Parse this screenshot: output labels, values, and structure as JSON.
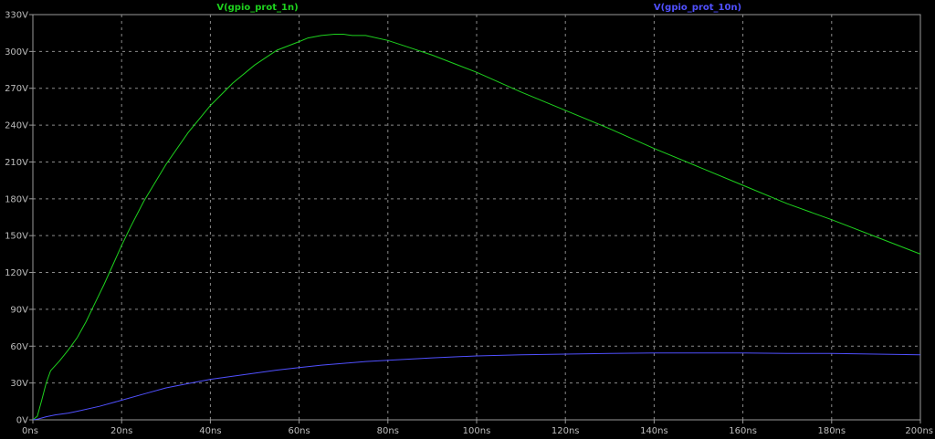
{
  "chart_data": {
    "type": "line",
    "title": "",
    "xlabel": "",
    "ylabel": "",
    "xlim": [
      0,
      200
    ],
    "ylim": [
      0,
      330
    ],
    "grid": true,
    "legend_placement": "top",
    "x_ticks": [
      0,
      20,
      40,
      60,
      80,
      100,
      120,
      140,
      160,
      180,
      200
    ],
    "x_tick_labels": [
      "0ns",
      "20ns",
      "40ns",
      "60ns",
      "80ns",
      "100ns",
      "120ns",
      "140ns",
      "160ns",
      "180ns",
      "200ns"
    ],
    "y_ticks": [
      0,
      30,
      60,
      90,
      120,
      150,
      180,
      210,
      240,
      270,
      300,
      330
    ],
    "y_tick_labels": [
      "0V",
      "30V",
      "60V",
      "90V",
      "120V",
      "150V",
      "180V",
      "210V",
      "240V",
      "270V",
      "300V",
      "330V"
    ],
    "series": [
      {
        "name": "V(gpio_prot_1n)",
        "color": "#1ed21e",
        "x": [
          0,
          1,
          2,
          3,
          4,
          5,
          6,
          8,
          10,
          12,
          14,
          16,
          18,
          20,
          22,
          25,
          28,
          30,
          35,
          40,
          45,
          50,
          55,
          60,
          62,
          65,
          68,
          70,
          72,
          75,
          80,
          85,
          90,
          100,
          110,
          120,
          130,
          140,
          150,
          160,
          170,
          180,
          190,
          200
        ],
        "y": [
          0,
          3,
          16,
          30,
          40,
          44,
          48,
          57,
          67,
          80,
          95,
          110,
          126,
          142,
          157,
          178,
          196,
          208,
          234,
          256,
          274,
          289,
          301,
          308,
          311,
          313,
          314,
          314,
          313,
          313,
          309,
          303,
          297,
          283,
          267,
          252,
          237,
          221,
          206,
          191,
          176,
          163,
          149,
          135
        ]
      },
      {
        "name": "V(gpio_prot_10n)",
        "color": "#5050ff",
        "x": [
          0,
          1,
          2,
          3,
          5,
          8,
          10,
          15,
          20,
          25,
          30,
          35,
          40,
          45,
          50,
          55,
          60,
          65,
          70,
          75,
          80,
          90,
          100,
          110,
          120,
          130,
          140,
          150,
          160,
          170,
          180,
          190,
          200
        ],
        "y": [
          0,
          0.5,
          1.5,
          2.5,
          4,
          5.5,
          7,
          11,
          16,
          21,
          26,
          29.5,
          33,
          35.5,
          38,
          40.5,
          42.5,
          44.5,
          46,
          47.5,
          48.5,
          50.5,
          52,
          53,
          53.5,
          54,
          54.5,
          54.5,
          54.5,
          54,
          54,
          53.5,
          53
        ]
      }
    ]
  }
}
